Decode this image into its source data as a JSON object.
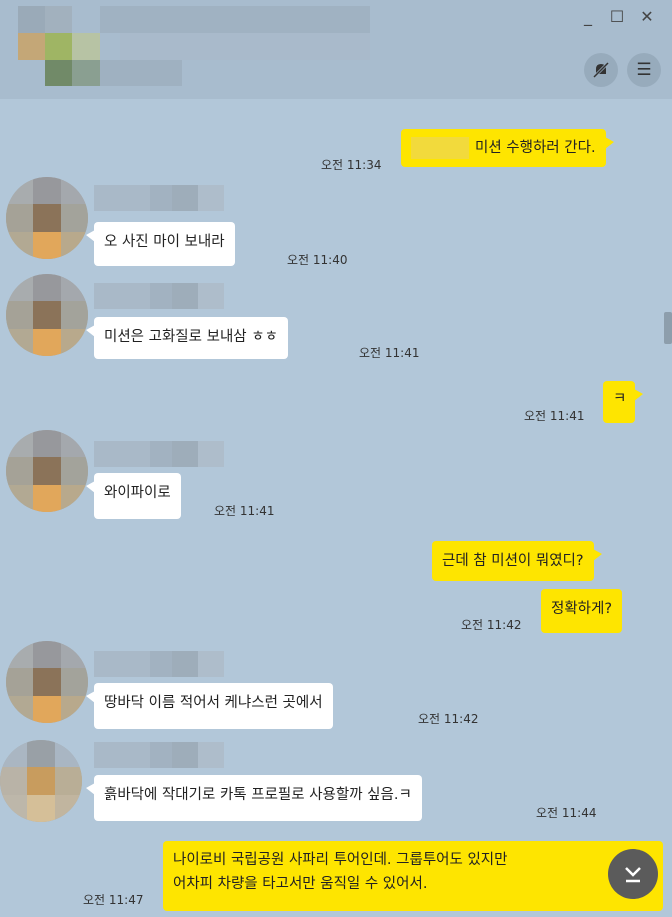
{
  "window": {
    "minimize_glyph": "_",
    "maximize_glyph": "☐",
    "close_glyph": "✕",
    "mute_icon": "bell-slash-icon",
    "menu_icon": "hamburger-menu-icon",
    "menu_glyph": "☰"
  },
  "messages": [
    {
      "side": "me",
      "text": "미션 수행하러 간다.",
      "time": "오전 11:34"
    },
    {
      "side": "other",
      "text": "오 사진 마이 보내라",
      "time": "오전 11:40"
    },
    {
      "side": "other",
      "text": "미션은 고화질로 보내삼 ㅎㅎ",
      "time": "오전 11:41"
    },
    {
      "side": "me",
      "text": "ㅋ",
      "time": "오전 11:41"
    },
    {
      "side": "other",
      "text": "와이파이로",
      "time": "오전 11:41"
    },
    {
      "side": "me",
      "text": "근데 참 미션이 뭐였디?",
      "time": ""
    },
    {
      "side": "me",
      "text": "정확하게?",
      "time": "오전 11:42"
    },
    {
      "side": "other",
      "text": "땅바닥 이름 적어서 케냐스런 곳에서",
      "time": "오전 11:42"
    },
    {
      "side": "other",
      "text": "흙바닥에 작대기로 카톡 프로필로 사용할까 싶음.ㅋ",
      "time": "오전 11:44"
    },
    {
      "side": "me",
      "text_line1": "나이로비 국립공원 사파리 투어인데. 그룹투어도 있지만",
      "text_line2": "어차피 차량을 타고서만 움직일 수 있어서.",
      "time": "오전 11:47"
    }
  ],
  "scroll_button": {
    "icon": "chevron-double-down-icon",
    "glyph": "⌄"
  },
  "colors": {
    "background": "#b2c7d9",
    "my_bubble": "#fee500",
    "other_bubble": "#ffffff"
  }
}
